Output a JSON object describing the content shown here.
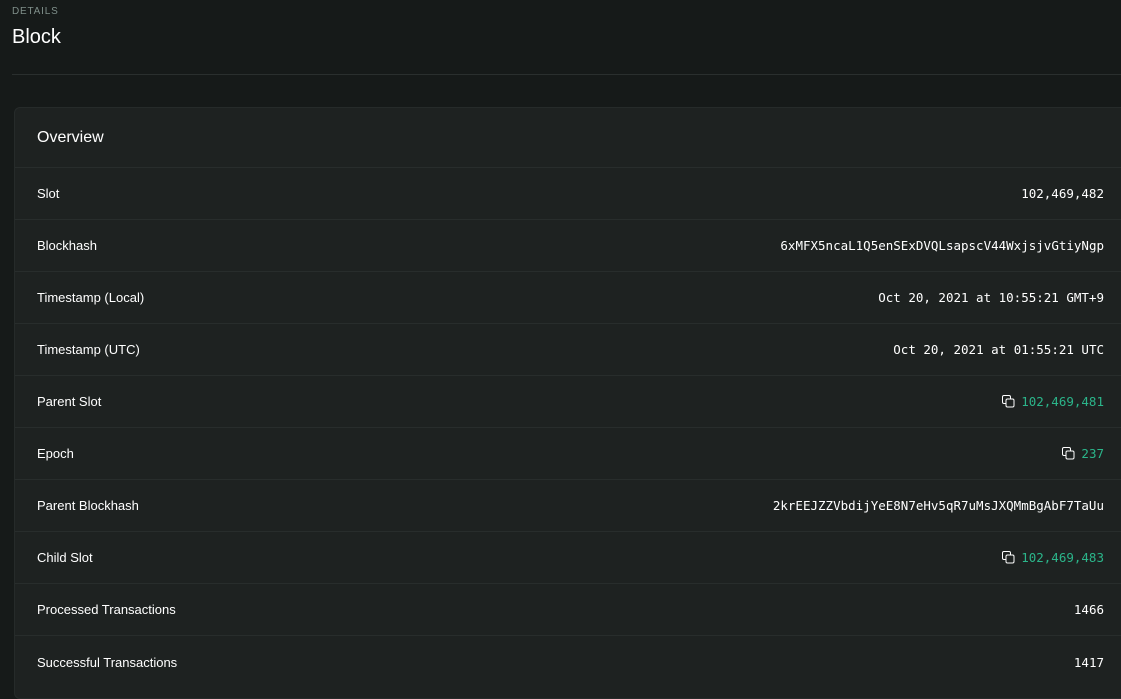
{
  "header": {
    "pretitle": "DETAILS",
    "title": "Block"
  },
  "overview": {
    "title": "Overview",
    "rows": [
      {
        "label": "Slot",
        "value": "102,469,482",
        "link": false
      },
      {
        "label": "Blockhash",
        "value": "6xMFX5ncaL1Q5enSExDVQLsapscV44WxjsjvGtiyNgp",
        "link": false
      },
      {
        "label": "Timestamp (Local)",
        "value": "Oct 20, 2021 at 10:55:21 GMT+9",
        "link": false
      },
      {
        "label": "Timestamp (UTC)",
        "value": "Oct 20, 2021 at 01:55:21 UTC",
        "link": false
      },
      {
        "label": "Parent Slot",
        "value": "102,469,481",
        "link": true
      },
      {
        "label": "Epoch",
        "value": "237",
        "link": true
      },
      {
        "label": "Parent Blockhash",
        "value": "2krEEJZZVbdijYeE8N7eHv5qR7uMsJXQMmBgAbF7TaUu",
        "link": false
      },
      {
        "label": "Child Slot",
        "value": "102,469,483",
        "link": true
      },
      {
        "label": "Processed Transactions",
        "value": "1466",
        "link": false
      },
      {
        "label": "Successful Transactions",
        "value": "1417",
        "link": false
      }
    ]
  },
  "colors": {
    "background": "#161a19",
    "card": "#1e2221",
    "link": "#2bb58a",
    "muted": "#7f8f8a"
  },
  "icons": {
    "copy": "copy-icon"
  }
}
